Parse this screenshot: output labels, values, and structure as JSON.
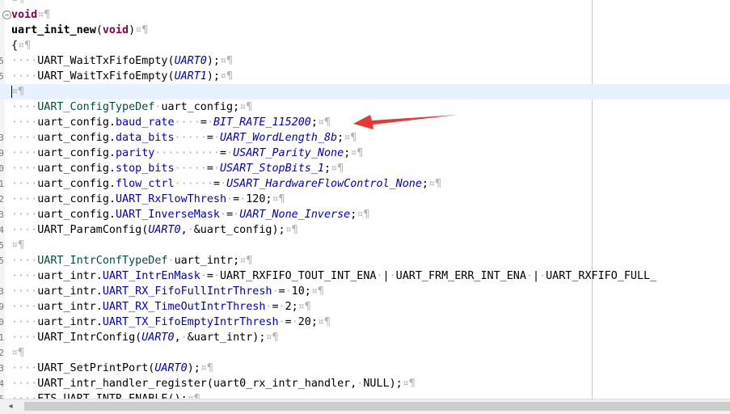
{
  "editor": {
    "scroll_left_icon": "◂",
    "lines": [
      {
        "ln": "",
        "current": false,
        "fold": false,
        "tokens": [
          {
            "c": "t-ws",
            "t": "¤¶"
          }
        ]
      },
      {
        "ln": "",
        "current": false,
        "fold": true,
        "tokens": [
          {
            "c": "t-keyword",
            "t": "void"
          },
          {
            "c": "t-ws",
            "t": "¤¶"
          }
        ]
      },
      {
        "ln": "",
        "current": false,
        "fold": false,
        "tokens": [
          {
            "c": "t-func",
            "t": "uart_init_new"
          },
          {
            "c": "t-default",
            "t": "("
          },
          {
            "c": "t-keyword",
            "t": "void"
          },
          {
            "c": "t-default",
            "t": ")"
          },
          {
            "c": "t-ws",
            "t": "¤¶"
          }
        ]
      },
      {
        "ln": "",
        "current": false,
        "fold": false,
        "tokens": [
          {
            "c": "t-default",
            "t": "{"
          },
          {
            "c": "t-ws",
            "t": "¤¶"
          }
        ]
      },
      {
        "ln": "5",
        "current": false,
        "fold": false,
        "tokens": [
          {
            "c": "t-ws",
            "t": "····"
          },
          {
            "c": "t-default",
            "t": "UART_WaitTxFifoEmpty("
          },
          {
            "c": "t-italic",
            "t": "UART0"
          },
          {
            "c": "t-default",
            "t": ");"
          },
          {
            "c": "t-ws",
            "t": "¤¶"
          }
        ]
      },
      {
        "ln": "5",
        "current": false,
        "fold": false,
        "tokens": [
          {
            "c": "t-ws",
            "t": "····"
          },
          {
            "c": "t-default",
            "t": "UART_WaitTxFifoEmpty("
          },
          {
            "c": "t-italic",
            "t": "UART1"
          },
          {
            "c": "t-default",
            "t": ");"
          },
          {
            "c": "t-ws",
            "t": "¤¶"
          }
        ]
      },
      {
        "ln": "",
        "current": true,
        "fold": false,
        "caret": true,
        "tokens": [
          {
            "c": "t-ws",
            "t": "¤¶"
          }
        ]
      },
      {
        "ln": "",
        "current": false,
        "fold": false,
        "tokens": [
          {
            "c": "t-ws",
            "t": "····"
          },
          {
            "c": "t-type",
            "t": "UART_ConfigTypeDef"
          },
          {
            "c": "t-ws",
            "t": "·"
          },
          {
            "c": "t-default",
            "t": "uart_config;"
          },
          {
            "c": "t-ws",
            "t": "¤¶"
          }
        ]
      },
      {
        "ln": "",
        "current": false,
        "fold": false,
        "tokens": [
          {
            "c": "t-ws",
            "t": "····"
          },
          {
            "c": "t-default",
            "t": "uart_config."
          },
          {
            "c": "t-field",
            "t": "baud_rate"
          },
          {
            "c": "t-ws",
            "t": "····"
          },
          {
            "c": "t-default",
            "t": "="
          },
          {
            "c": "t-ws",
            "t": "·"
          },
          {
            "c": "t-italic",
            "t": "BIT_RATE_115200"
          },
          {
            "c": "t-default",
            "t": ";"
          },
          {
            "c": "t-ws",
            "t": "¤¶"
          }
        ]
      },
      {
        "ln": "3",
        "current": false,
        "fold": false,
        "tokens": [
          {
            "c": "t-ws",
            "t": "····"
          },
          {
            "c": "t-default",
            "t": "uart_config."
          },
          {
            "c": "t-field",
            "t": "data_bits"
          },
          {
            "c": "t-ws",
            "t": "·····"
          },
          {
            "c": "t-default",
            "t": "="
          },
          {
            "c": "t-ws",
            "t": "·"
          },
          {
            "c": "t-italic",
            "t": "UART_WordLength_8b"
          },
          {
            "c": "t-default",
            "t": ";"
          },
          {
            "c": "t-ws",
            "t": "¤¶"
          }
        ]
      },
      {
        "ln": "9",
        "current": false,
        "fold": false,
        "tokens": [
          {
            "c": "t-ws",
            "t": "····"
          },
          {
            "c": "t-default",
            "t": "uart_config."
          },
          {
            "c": "t-field",
            "t": "parity"
          },
          {
            "c": "t-ws",
            "t": "··········"
          },
          {
            "c": "t-default",
            "t": "="
          },
          {
            "c": "t-ws",
            "t": "·"
          },
          {
            "c": "t-italic",
            "t": "USART_Parity_None"
          },
          {
            "c": "t-default",
            "t": ";"
          },
          {
            "c": "t-ws",
            "t": "¤¶"
          }
        ]
      },
      {
        "ln": "0",
        "current": false,
        "fold": false,
        "tokens": [
          {
            "c": "t-ws",
            "t": "····"
          },
          {
            "c": "t-default",
            "t": "uart_config."
          },
          {
            "c": "t-field",
            "t": "stop_bits"
          },
          {
            "c": "t-ws",
            "t": "·····"
          },
          {
            "c": "t-default",
            "t": "="
          },
          {
            "c": "t-ws",
            "t": "·"
          },
          {
            "c": "t-italic",
            "t": "USART_StopBits_1"
          },
          {
            "c": "t-default",
            "t": ";"
          },
          {
            "c": "t-ws",
            "t": "¤¶"
          }
        ]
      },
      {
        "ln": "1",
        "current": false,
        "fold": false,
        "tokens": [
          {
            "c": "t-ws",
            "t": "····"
          },
          {
            "c": "t-default",
            "t": "uart_config."
          },
          {
            "c": "t-field",
            "t": "flow_ctrl"
          },
          {
            "c": "t-ws",
            "t": "······"
          },
          {
            "c": "t-default",
            "t": "="
          },
          {
            "c": "t-ws",
            "t": "·"
          },
          {
            "c": "t-italic",
            "t": "USART_HardwareFlowControl_None"
          },
          {
            "c": "t-default",
            "t": ";"
          },
          {
            "c": "t-ws",
            "t": "¤¶"
          }
        ]
      },
      {
        "ln": "2",
        "current": false,
        "fold": false,
        "tokens": [
          {
            "c": "t-ws",
            "t": "····"
          },
          {
            "c": "t-default",
            "t": "uart_config."
          },
          {
            "c": "t-field",
            "t": "UART_RxFlowThresh"
          },
          {
            "c": "t-ws",
            "t": "·"
          },
          {
            "c": "t-default",
            "t": "="
          },
          {
            "c": "t-ws",
            "t": "·"
          },
          {
            "c": "t-default",
            "t": "120;"
          },
          {
            "c": "t-ws",
            "t": "¤¶"
          }
        ]
      },
      {
        "ln": "3",
        "current": false,
        "fold": false,
        "tokens": [
          {
            "c": "t-ws",
            "t": "····"
          },
          {
            "c": "t-default",
            "t": "uart_config."
          },
          {
            "c": "t-field",
            "t": "UART_InverseMask"
          },
          {
            "c": "t-ws",
            "t": "·"
          },
          {
            "c": "t-default",
            "t": "="
          },
          {
            "c": "t-ws",
            "t": "·"
          },
          {
            "c": "t-italic",
            "t": "UART_None_Inverse"
          },
          {
            "c": "t-default",
            "t": ";"
          },
          {
            "c": "t-ws",
            "t": "¤¶"
          }
        ]
      },
      {
        "ln": "4",
        "current": false,
        "fold": false,
        "tokens": [
          {
            "c": "t-ws",
            "t": "····"
          },
          {
            "c": "t-default",
            "t": "UART_ParamConfig("
          },
          {
            "c": "t-italic",
            "t": "UART0"
          },
          {
            "c": "t-default",
            "t": ","
          },
          {
            "c": "t-ws",
            "t": "·"
          },
          {
            "c": "t-default",
            "t": "&uart_config);"
          },
          {
            "c": "t-ws",
            "t": "¤¶"
          }
        ]
      },
      {
        "ln": "5",
        "current": false,
        "fold": false,
        "tokens": [
          {
            "c": "t-ws",
            "t": "¤¶"
          }
        ]
      },
      {
        "ln": "5",
        "current": false,
        "fold": false,
        "tokens": [
          {
            "c": "t-ws",
            "t": "····"
          },
          {
            "c": "t-type",
            "t": "UART_IntrConfTypeDef"
          },
          {
            "c": "t-ws",
            "t": "·"
          },
          {
            "c": "t-default",
            "t": "uart_intr;"
          },
          {
            "c": "t-ws",
            "t": "¤¶"
          }
        ]
      },
      {
        "ln": "",
        "current": false,
        "fold": false,
        "tokens": [
          {
            "c": "t-ws",
            "t": "····"
          },
          {
            "c": "t-default",
            "t": "uart_intr."
          },
          {
            "c": "t-field",
            "t": "UART_IntrEnMask"
          },
          {
            "c": "t-ws",
            "t": "·"
          },
          {
            "c": "t-default",
            "t": "="
          },
          {
            "c": "t-ws",
            "t": "·"
          },
          {
            "c": "t-default",
            "t": "UART_RXFIFO_TOUT_INT_ENA"
          },
          {
            "c": "t-ws",
            "t": "·"
          },
          {
            "c": "t-default",
            "t": "|"
          },
          {
            "c": "t-ws",
            "t": "·"
          },
          {
            "c": "t-default",
            "t": "UART_FRM_ERR_INT_ENA"
          },
          {
            "c": "t-ws",
            "t": "·"
          },
          {
            "c": "t-default",
            "t": "|"
          },
          {
            "c": "t-ws",
            "t": "·"
          },
          {
            "c": "t-default",
            "t": "UART_RXFIFO_FULL_"
          }
        ]
      },
      {
        "ln": "3",
        "current": false,
        "fold": false,
        "tokens": [
          {
            "c": "t-ws",
            "t": "····"
          },
          {
            "c": "t-default",
            "t": "uart_intr."
          },
          {
            "c": "t-field",
            "t": "UART_RX_FifoFullIntrThresh"
          },
          {
            "c": "t-ws",
            "t": "·"
          },
          {
            "c": "t-default",
            "t": "="
          },
          {
            "c": "t-ws",
            "t": "·"
          },
          {
            "c": "t-default",
            "t": "10;"
          },
          {
            "c": "t-ws",
            "t": "¤¶"
          }
        ]
      },
      {
        "ln": "9",
        "current": false,
        "fold": false,
        "tokens": [
          {
            "c": "t-ws",
            "t": "····"
          },
          {
            "c": "t-default",
            "t": "uart_intr."
          },
          {
            "c": "t-field",
            "t": "UART_RX_TimeOutIntrThresh"
          },
          {
            "c": "t-ws",
            "t": "·"
          },
          {
            "c": "t-default",
            "t": "="
          },
          {
            "c": "t-ws",
            "t": "·"
          },
          {
            "c": "t-default",
            "t": "2;"
          },
          {
            "c": "t-ws",
            "t": "¤¶"
          }
        ]
      },
      {
        "ln": "0",
        "current": false,
        "fold": false,
        "tokens": [
          {
            "c": "t-ws",
            "t": "····"
          },
          {
            "c": "t-default",
            "t": "uart_intr."
          },
          {
            "c": "t-field",
            "t": "UART_TX_FifoEmptyIntrThresh"
          },
          {
            "c": "t-ws",
            "t": "·"
          },
          {
            "c": "t-default",
            "t": "="
          },
          {
            "c": "t-ws",
            "t": "·"
          },
          {
            "c": "t-default",
            "t": "20;"
          },
          {
            "c": "t-ws",
            "t": "¤¶"
          }
        ]
      },
      {
        "ln": "1",
        "current": false,
        "fold": false,
        "tokens": [
          {
            "c": "t-ws",
            "t": "····"
          },
          {
            "c": "t-default",
            "t": "UART_IntrConfig("
          },
          {
            "c": "t-italic",
            "t": "UART0"
          },
          {
            "c": "t-default",
            "t": ","
          },
          {
            "c": "t-ws",
            "t": "·"
          },
          {
            "c": "t-default",
            "t": "&uart_intr);"
          },
          {
            "c": "t-ws",
            "t": "¤¶"
          }
        ]
      },
      {
        "ln": "2",
        "current": false,
        "fold": false,
        "tokens": [
          {
            "c": "t-ws",
            "t": "¤¶"
          }
        ]
      },
      {
        "ln": "3",
        "current": false,
        "fold": false,
        "tokens": [
          {
            "c": "t-ws",
            "t": "····"
          },
          {
            "c": "t-default",
            "t": "UART_SetPrintPort("
          },
          {
            "c": "t-italic",
            "t": "UART0"
          },
          {
            "c": "t-default",
            "t": ");"
          },
          {
            "c": "t-ws",
            "t": "¤¶"
          }
        ]
      },
      {
        "ln": "4",
        "current": false,
        "fold": false,
        "tokens": [
          {
            "c": "t-ws",
            "t": "····"
          },
          {
            "c": "t-default",
            "t": "UART_intr_handler_register(uart0_rx_intr_handler,"
          },
          {
            "c": "t-ws",
            "t": "·"
          },
          {
            "c": "t-default",
            "t": "NULL);"
          },
          {
            "c": "t-ws",
            "t": "¤¶"
          }
        ]
      },
      {
        "ln": "5",
        "current": false,
        "fold": false,
        "tokens": [
          {
            "c": "t-ws",
            "t": "····"
          },
          {
            "c": "t-default",
            "t": "ETS_UART_INTR_ENABLE();"
          },
          {
            "c": "t-ws",
            "t": "¤¶"
          }
        ]
      }
    ],
    "annotation_color": "#e53935"
  }
}
